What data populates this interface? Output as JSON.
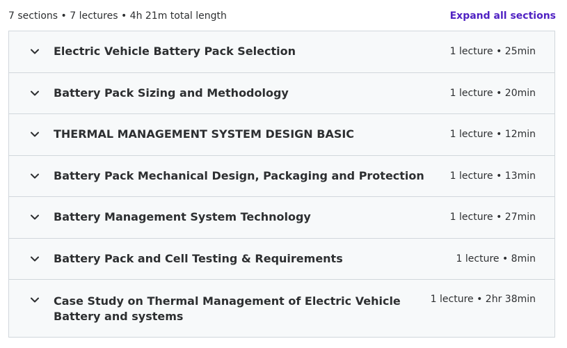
{
  "summary": {
    "text": "7 sections • 7 lectures • 4h 21m total length",
    "expand_label": "Expand all sections"
  },
  "colors": {
    "accent": "#5022c3",
    "section_background": "#f7f9fa",
    "border": "#d1d7dc",
    "text": "#2d2f31"
  },
  "sections": [
    {
      "title": "Electric Vehicle Battery Pack Selection",
      "meta": "1 lecture • 25min",
      "icon": "chevron-down-icon"
    },
    {
      "title": "Battery Pack Sizing and Methodology",
      "meta": "1 lecture • 20min",
      "icon": "chevron-down-icon"
    },
    {
      "title": "THERMAL MANAGEMENT SYSTEM DESIGN BASIC",
      "meta": "1 lecture • 12min",
      "icon": "chevron-down-icon"
    },
    {
      "title": "Battery Pack Mechanical Design, Packaging and Protection",
      "meta": "1 lecture • 13min",
      "icon": "chevron-down-icon"
    },
    {
      "title": "Battery Management System Technology",
      "meta": "1 lecture • 27min",
      "icon": "chevron-down-icon"
    },
    {
      "title": "Battery Pack and Cell Testing & Requirements",
      "meta": "1 lecture • 8min",
      "icon": "chevron-down-icon"
    },
    {
      "title": "Case Study on Thermal Management of Electric Vehicle Battery and systems",
      "meta": "1 lecture • 2hr 38min",
      "icon": "chevron-down-icon"
    }
  ]
}
